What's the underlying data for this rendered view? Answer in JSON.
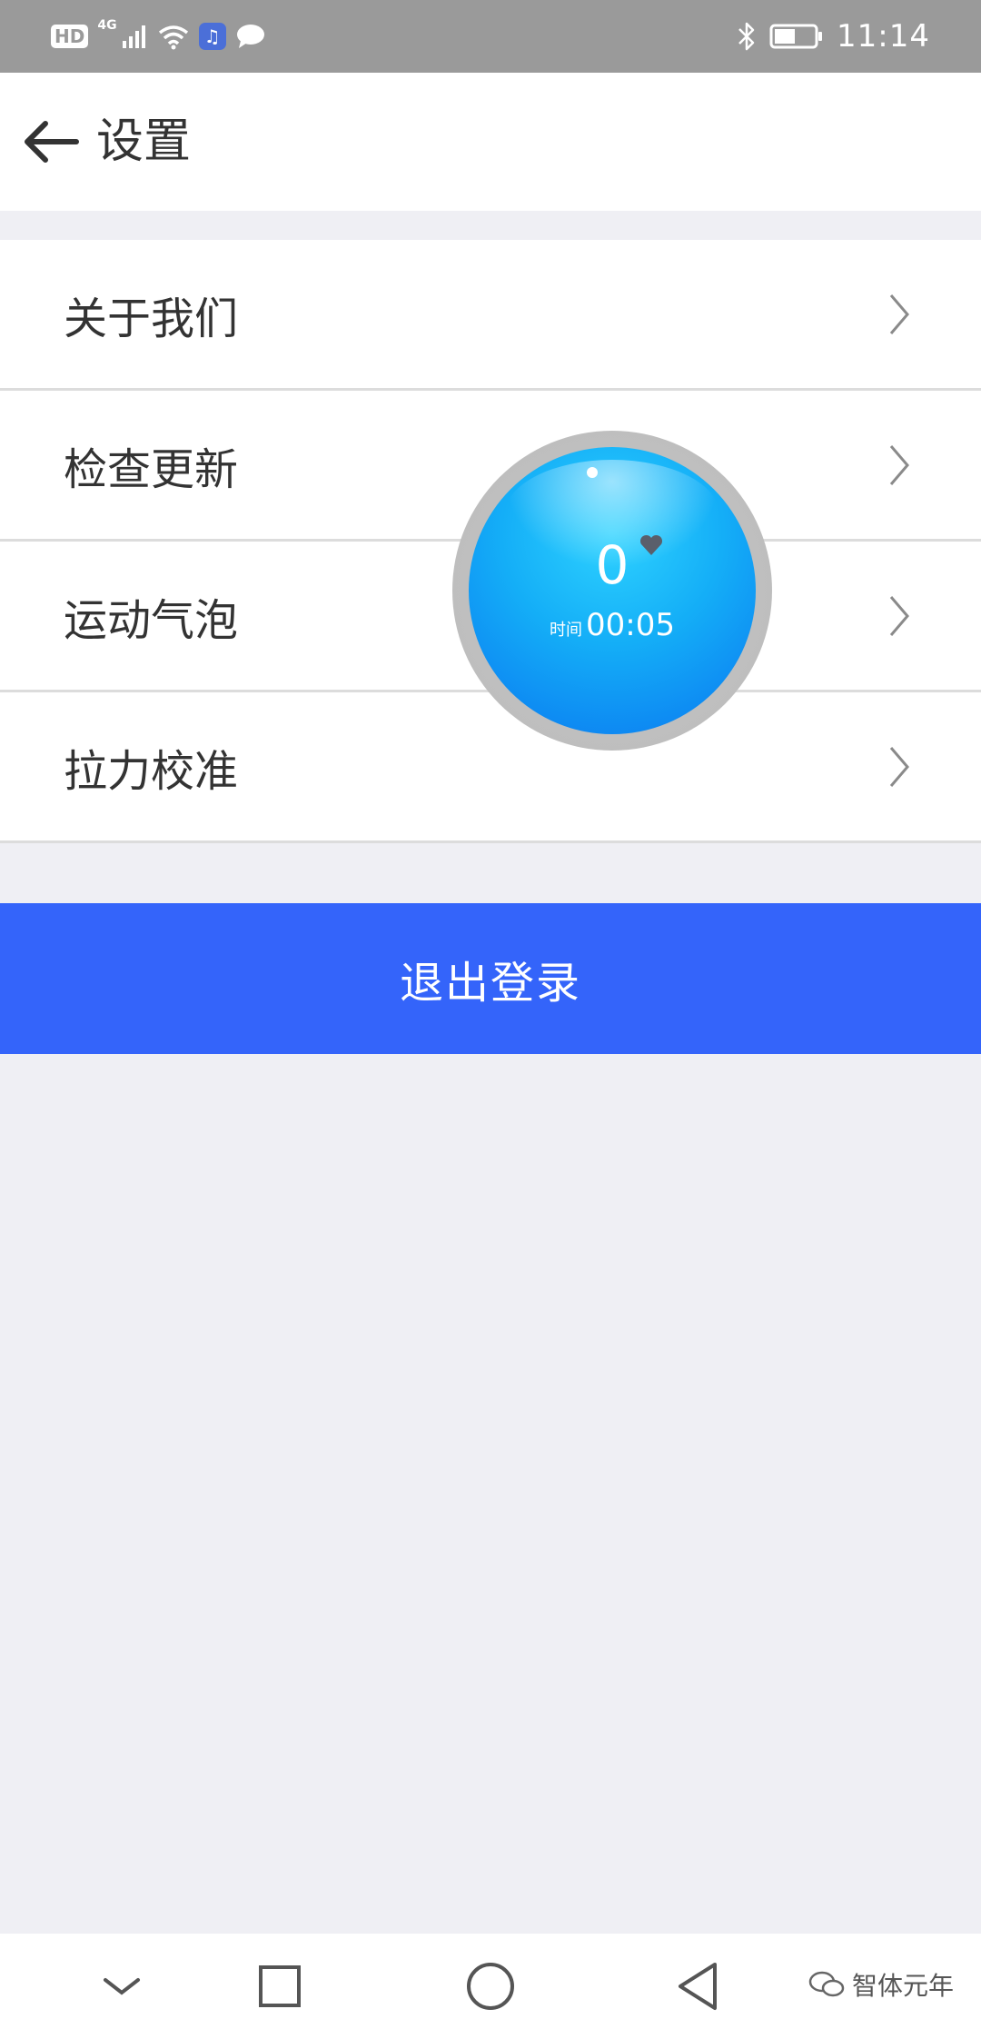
{
  "status_bar": {
    "hd": "HD",
    "network": "4G",
    "time": "11:14",
    "icons": [
      "signal-icon",
      "wifi-icon",
      "music-app-icon",
      "message-icon",
      "bluetooth-icon",
      "battery-icon"
    ]
  },
  "header": {
    "title": "设置"
  },
  "settings": {
    "items": [
      {
        "label": "关于我们"
      },
      {
        "label": "检查更新"
      },
      {
        "label": "运动气泡"
      },
      {
        "label": "拉力校准"
      }
    ]
  },
  "logout": {
    "label": "退出登录"
  },
  "bubble": {
    "count": "0",
    "time_label": "时间",
    "time_value": "00:05"
  },
  "watermark": {
    "text": "智体元年"
  },
  "colors": {
    "accent": "#3464fa",
    "status_bar": "#9a9a9a",
    "background": "#efeff4",
    "bubble": "#14aef7"
  }
}
